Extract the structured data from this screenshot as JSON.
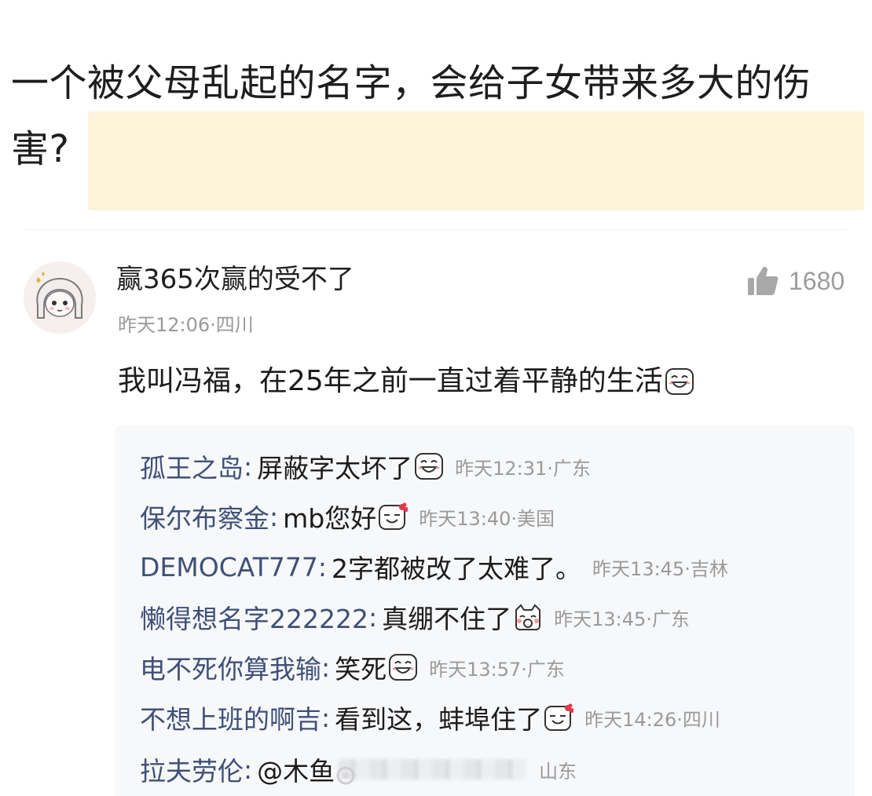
{
  "question": {
    "line1": "一个被父母乱起的名字，会给子女带来多大的伤",
    "line2": "害?"
  },
  "answer": {
    "username": "赢365次赢的受不了",
    "likes": "1680",
    "meta": "昨天12:06·四川",
    "text": "我叫冯福，在25年之前一直过着平静的生活"
  },
  "replies": [
    {
      "user": "孤王之岛",
      "text": "屏蔽字太坏了",
      "emoji": "grin-emoji",
      "meta": "昨天12:31·广东"
    },
    {
      "user": "保尔布察金",
      "text": "mb您好",
      "emoji": "bow-smile-emoji",
      "meta": "昨天13:40·美国"
    },
    {
      "user": "DEMOCAT777",
      "text": "2字都被改了太难了。",
      "emoji": "",
      "meta": "昨天13:45·吉林"
    },
    {
      "user": "懒得想名字222222",
      "text": "真绷不住了",
      "emoji": "cat-laugh-emoji",
      "meta": "昨天13:45·广东"
    },
    {
      "user": "电不死你算我输",
      "text": "笑死",
      "emoji": "grin-emoji",
      "meta": "昨天13:57·广东"
    },
    {
      "user": "不想上班的啊吉",
      "text": "看到这，蚌埠住了",
      "emoji": "bow-smile-emoji",
      "meta": "昨天14:26·四川"
    },
    {
      "user": "拉夫劳伦",
      "text": "@木鱼",
      "emoji": "",
      "meta": "山东"
    }
  ],
  "colors": {
    "username_blue": "#3f5078",
    "meta_gray": "#9a9a9a",
    "highlight": "#fbf3da",
    "panel": "#f7f8fa"
  }
}
